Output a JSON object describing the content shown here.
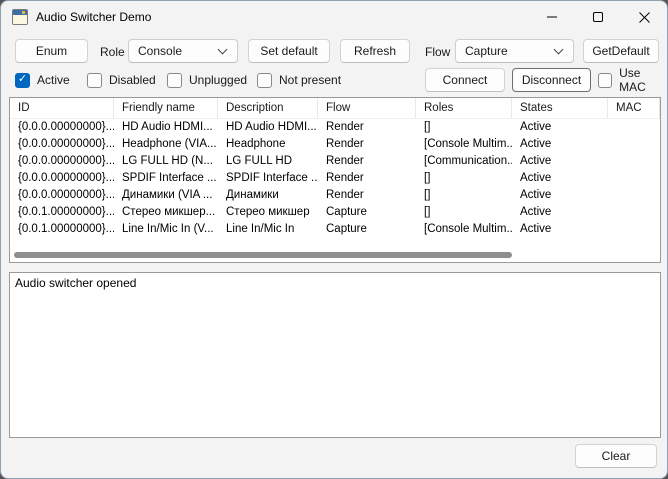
{
  "window": {
    "title": "Audio Switcher Demo"
  },
  "toolbar": {
    "enum_label": "Enum",
    "role_label": "Role",
    "role_value": "Console",
    "set_default_label": "Set default",
    "refresh_label": "Refresh",
    "flow_label": "Flow",
    "flow_value": "Capture",
    "get_default_label": "GetDefault"
  },
  "filters": {
    "active": {
      "label": "Active",
      "checked": true
    },
    "disabled": {
      "label": "Disabled",
      "checked": false
    },
    "unplugged": {
      "label": "Unplugged",
      "checked": false
    },
    "not_present": {
      "label": "Not present",
      "checked": false
    },
    "connect_label": "Connect",
    "disconnect_label": "Disconnect",
    "use_mac": {
      "label": "Use MAC",
      "checked": false
    }
  },
  "table": {
    "columns": [
      "ID",
      "Friendly name",
      "Description",
      "Flow",
      "Roles",
      "States",
      "MAC"
    ],
    "rows": [
      [
        "{0.0.0.00000000}...",
        "HD Audio HDMI...",
        "HD Audio HDMI...",
        "Render",
        "[]",
        "Active",
        ""
      ],
      [
        "{0.0.0.00000000}...",
        "Headphone (VIA...",
        "Headphone",
        "Render",
        "[Console Multim...",
        "Active",
        ""
      ],
      [
        "{0.0.0.00000000}...",
        "LG FULL HD (N...",
        "LG FULL HD",
        "Render",
        "[Communication...",
        "Active",
        ""
      ],
      [
        "{0.0.0.00000000}...",
        "SPDIF Interface ...",
        "SPDIF Interface ...",
        "Render",
        "[]",
        "Active",
        ""
      ],
      [
        "{0.0.0.00000000}...",
        "Динамики (VIA ...",
        "Динамики",
        "Render",
        "[]",
        "Active",
        ""
      ],
      [
        "{0.0.1.00000000}...",
        "Стерео микшер...",
        "Стерео микшер",
        "Capture",
        "[]",
        "Active",
        ""
      ],
      [
        "{0.0.1.00000000}...",
        "Line In/Mic In (V...",
        "Line In/Mic In",
        "Capture",
        "[Console Multim...",
        "Active",
        ""
      ]
    ]
  },
  "log": {
    "text": "Audio switcher opened"
  },
  "footer": {
    "clear_label": "Clear"
  },
  "colors": {
    "accent": "#0067c0",
    "window_bg": "#f3f3f3",
    "surface": "#ffffff"
  }
}
